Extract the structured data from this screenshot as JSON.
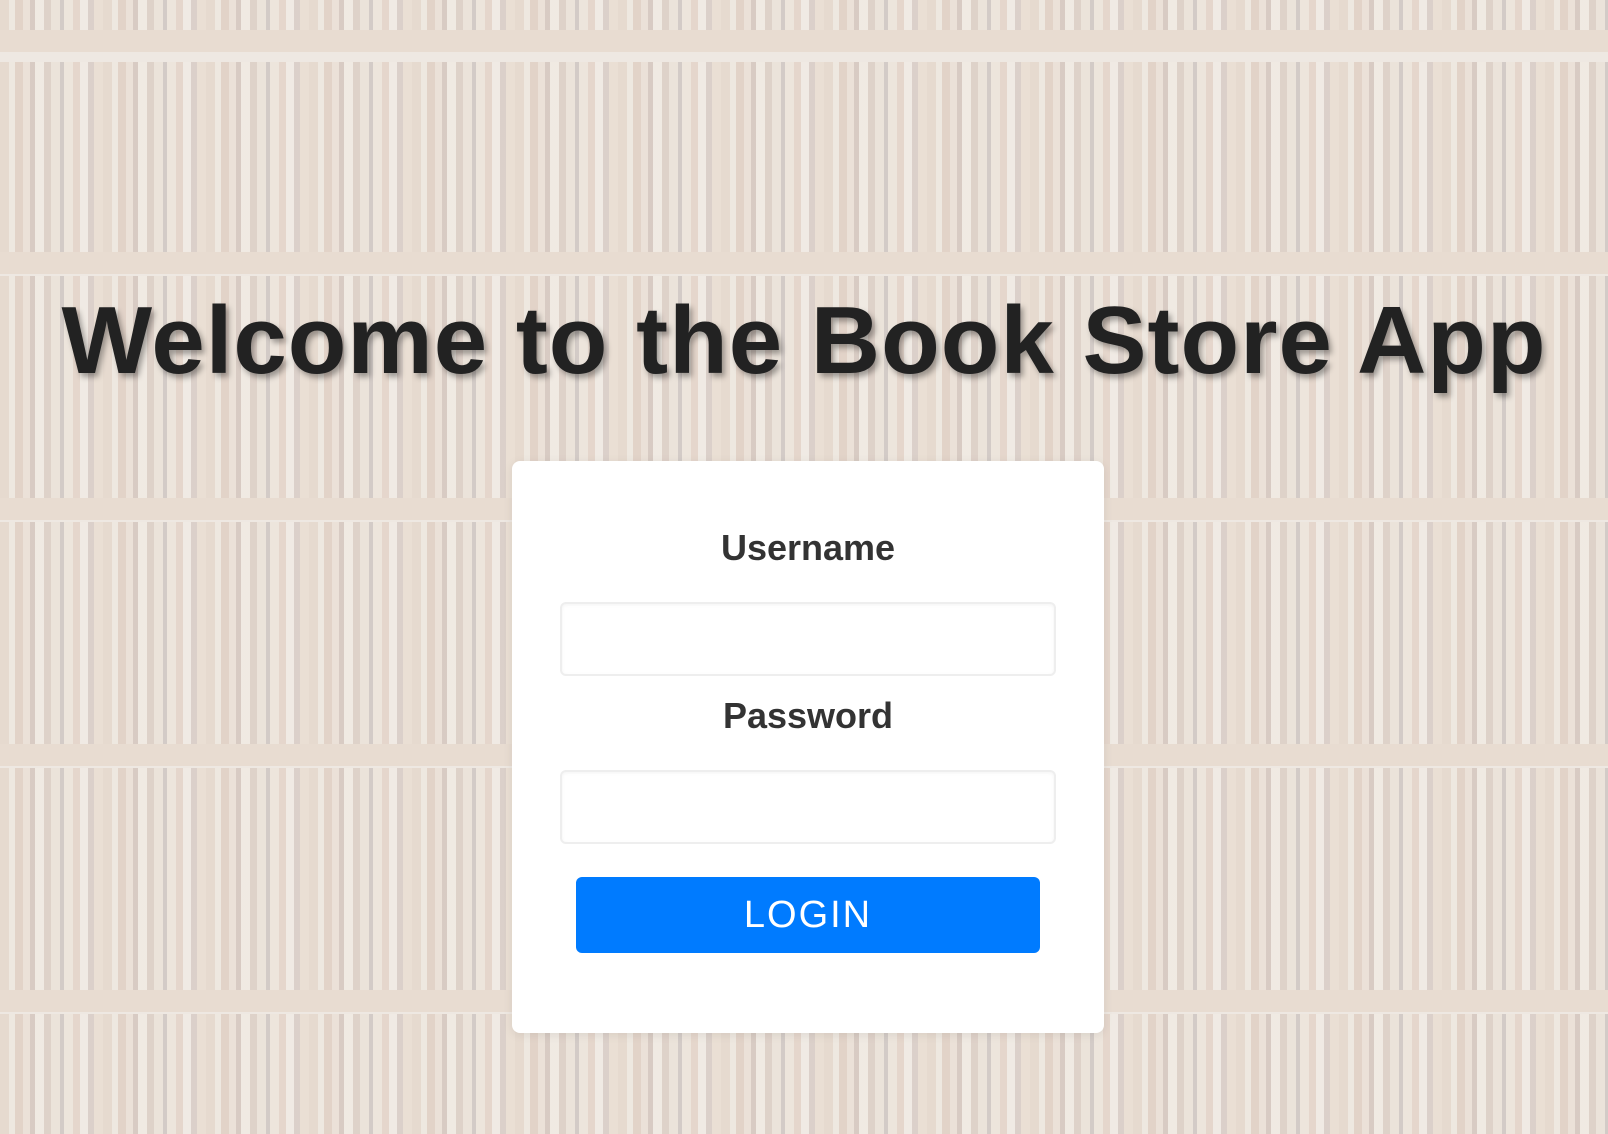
{
  "page": {
    "title": "Welcome to the Book Store App"
  },
  "login_form": {
    "username_label": "Username",
    "username_value": "",
    "password_label": "Password",
    "password_value": "",
    "submit_label": "LOGIN"
  },
  "colors": {
    "button_background": "#007bff",
    "button_text": "#ffffff",
    "title_text": "#222222",
    "card_background": "#ffffff"
  }
}
